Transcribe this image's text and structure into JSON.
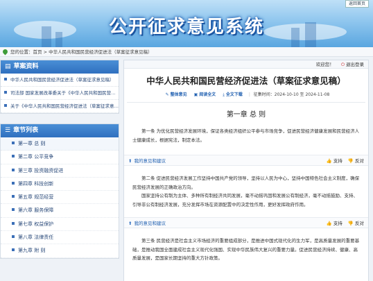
{
  "banner": {
    "title": "公开征求意见系统",
    "back_home": "返回首页"
  },
  "location": {
    "label": "您的位置：",
    "home": "首页",
    "separator": " > ",
    "current": "中华人民共和国民营经济促进法（草案征求意见稿）"
  },
  "sidebar": {
    "draft_panel": {
      "title": "草案资料",
      "icon": "book-icon",
      "items": [
        "中华人民共和国民营经济促进法（草案征求意见稿）",
        "司法部 国家发展改革委关于《中华人民共和国民营经济促进法（草案征求意见稿）》公开征求意见的通知",
        "关于《中华人民共和国民营经济促进法（草案征求意见稿）》的说明"
      ]
    },
    "chapter_panel": {
      "title": "章节列表",
      "icon": "list-icon",
      "items": [
        "第一章 总 则",
        "第二章 公平竞争",
        "第三章 投资融资促进",
        "第四章 科技创新",
        "第五章 规范经营",
        "第六章 服务保障",
        "第七章 权益保护",
        "第八章 法律责任",
        "第九章 附 则"
      ]
    }
  },
  "userbar": {
    "welcome": "欢迎您！",
    "logout": "退出登录"
  },
  "document": {
    "title": "中华人民共和国民营经济促进法（草案征求意见稿）",
    "toolbar": {
      "full_opinion": "整体意见",
      "read_full": "阅读全文",
      "download": "全文下载",
      "period_label": "征集时间：",
      "period": "2024-10-10 至 2024-11-08"
    },
    "chapter_title": "第一章 总 则",
    "articles": [
      "第一条 为优化民营经济发展环境，保证各类经济组织公平参与市场竞争，促进民营经济健康发展和民营经济人士健康成长，根据宪法，制定本法。",
      "第二条 促进民营经济发展工作坚持中国共产党的领导，坚持以人民为中心，坚持中国特色社会主义制度，确保民营经济发展的正确政治方向。",
      "国家坚持公有制为主体、多种所有制经济共同发展，毫不动摇巩固和发展公有制经济，毫不动摇鼓励、支持、引导非公有制经济发展，充分发挥市场在资源配置中的决定性作用，更好发挥政府作用。",
      "第三条 民营经济是社会主义市场经济的重要组成部分，是推进中国式现代化的生力军，是高质量发展的重要基础，是推动我国全面建成社会主义现代化强国、实现中华民族伟大复兴的重要力量。促进民营经济持续、健康、高质量发展，是国家长期坚持的重大方针政策。"
    ],
    "opinion_bar": {
      "my_opinion": "我的意见和建议",
      "support": "支持",
      "oppose": "反对"
    }
  }
}
